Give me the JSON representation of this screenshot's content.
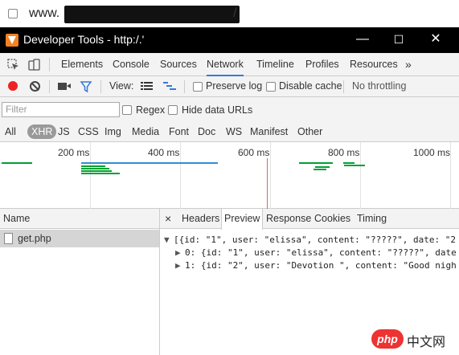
{
  "browser": {
    "url_prefix": "www.",
    "url_suffix": "/"
  },
  "titlebar": {
    "title": "Developer Tools - http:/.'",
    "minimize": "—",
    "maximize": "☐",
    "close": "✕"
  },
  "tabs": [
    "Elements",
    "Console",
    "Sources",
    "Network",
    "Timeline",
    "Profiles",
    "Resources",
    "»"
  ],
  "active_tab": "Network",
  "toolbar": {
    "view_label": "View:",
    "preserve_log": "Preserve log",
    "disable_cache": "Disable cache",
    "throttling": "No throttling"
  },
  "filter": {
    "placeholder": "Filter",
    "regex": "Regex",
    "hide_data_urls": "Hide data URLs"
  },
  "types": [
    "All",
    "XHR",
    "JS",
    "CSS",
    "Img",
    "Media",
    "Font",
    "Doc",
    "WS",
    "Manifest",
    "Other"
  ],
  "selected_type": "XHR",
  "overview": {
    "ticks": [
      "200 ms",
      "400 ms",
      "600 ms",
      "800 ms",
      "1000 ms"
    ],
    "colors": {
      "waiting": "#00a032",
      "receiving": "#2f8ed8",
      "marker": "#d66666"
    }
  },
  "requests": {
    "header": "Name",
    "items": [
      {
        "name": "get.php"
      }
    ]
  },
  "detail": {
    "close": "×",
    "tabs": [
      "Headers",
      "Preview",
      "Response",
      "Cookies",
      "Timing"
    ],
    "active_tab": "Preview",
    "lines": [
      {
        "arrow": "▼",
        "text": "[{id: \"1\", user: \"elissa\", content: \"?????\", date: \"2"
      },
      {
        "arrow": "▶",
        "text": "0: {id: \"1\", user: \"elissa\", content: \"?????\", date"
      },
      {
        "arrow": "▶",
        "text": "1: {id: \"2\", user: \"Devotion \", content: \"Good nigh"
      }
    ]
  },
  "watermark": {
    "badge": "php",
    "site": "中文网"
  }
}
